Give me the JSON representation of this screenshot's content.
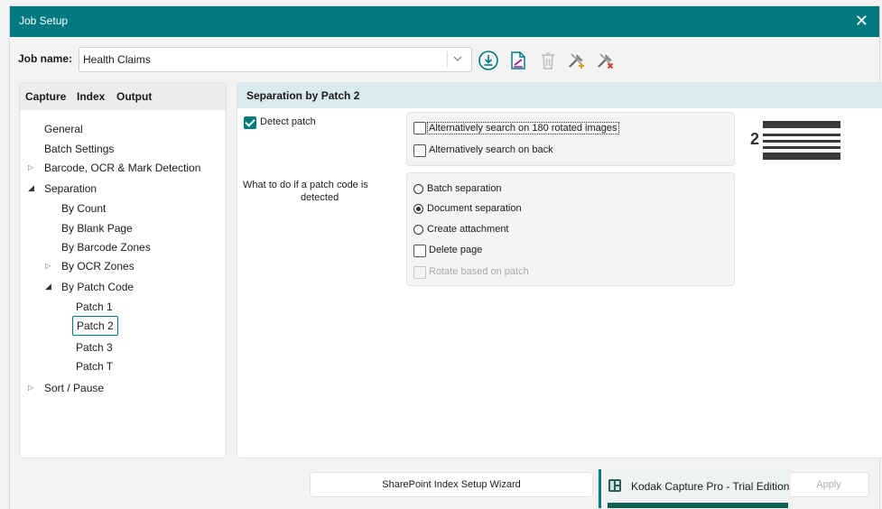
{
  "window": {
    "title": "Job Setup",
    "close_symbol": "✕"
  },
  "job": {
    "label": "Job name:",
    "value": "Health Claims"
  },
  "toolbar": [
    "download-icon",
    "edit-document-icon",
    "trash-icon",
    "tools-add-icon",
    "tools-remove-icon"
  ],
  "tabs": [
    "Capture",
    "Index",
    "Output"
  ],
  "tree": {
    "general": "General",
    "batch_settings": "Batch Settings",
    "barcode": "Barcode, OCR & Mark Detection",
    "separation": "Separation",
    "by_count": "By Count",
    "by_blank_page": "By Blank Page",
    "by_barcode_zones": "By Barcode Zones",
    "by_ocr_zones": "By OCR Zones",
    "by_patch_code": "By Patch Code",
    "patch1": "Patch 1",
    "patch2": "Patch 2",
    "patch3": "Patch 3",
    "patcht": "Patch T",
    "sort_pause": "Sort / Pause"
  },
  "panel": {
    "title": "Separation by Patch 2",
    "detect_patch": "Detect patch",
    "alt_rotated": "Alternatively search on 180 rotated images",
    "alt_back": "Alternatively search on back",
    "what_to_do_line1": "What to do if a patch code is",
    "what_to_do_line2": "detected",
    "options": {
      "batch_separation": "Batch separation",
      "document_separation": "Document separation",
      "create_attachment": "Create attachment",
      "delete_page": "Delete page",
      "rotate_based": "Rotate based on patch"
    },
    "patch_number": "2"
  },
  "buttons": {
    "sharepoint": "SharePoint Index Setup Wizard",
    "apply": "Apply"
  },
  "taskbar": {
    "label": "Kodak Capture Pro - Trial Edition"
  },
  "colors": {
    "accent": "#007a80",
    "section_bg": "#d9ebef"
  }
}
